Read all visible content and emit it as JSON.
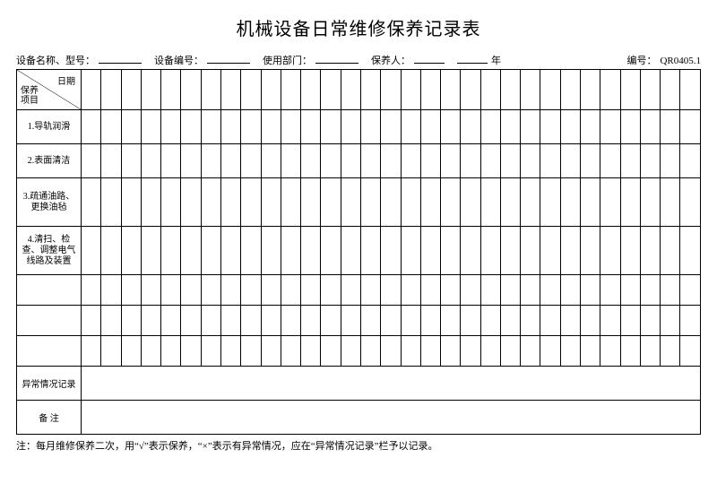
{
  "title": "机械设备日常维修保养记录表",
  "header": {
    "device_name_label": "设备名称、型号：",
    "device_no_label": "设备编号：",
    "dept_label": "使用部门：",
    "keeper_label": "保养人：",
    "year_label": "年",
    "form_no_label": "编号：",
    "form_no": "QR0405.1"
  },
  "diag": {
    "top": "日期",
    "bottom": "保养\n 项目"
  },
  "items": [
    "1.导轨润滑",
    "2.表面清洁",
    "3.疏通油路、更换油毡",
    "4.清扫、检查、调整电气线路及装置"
  ],
  "abnormal_label": "异常情况记录",
  "remark_label": "备 注",
  "footnote": "注：每月维修保养二次，用“√”表示保养，“×”表示有异常情况，应在“异常情况记录”栏予以记录。",
  "num_columns": 31
}
